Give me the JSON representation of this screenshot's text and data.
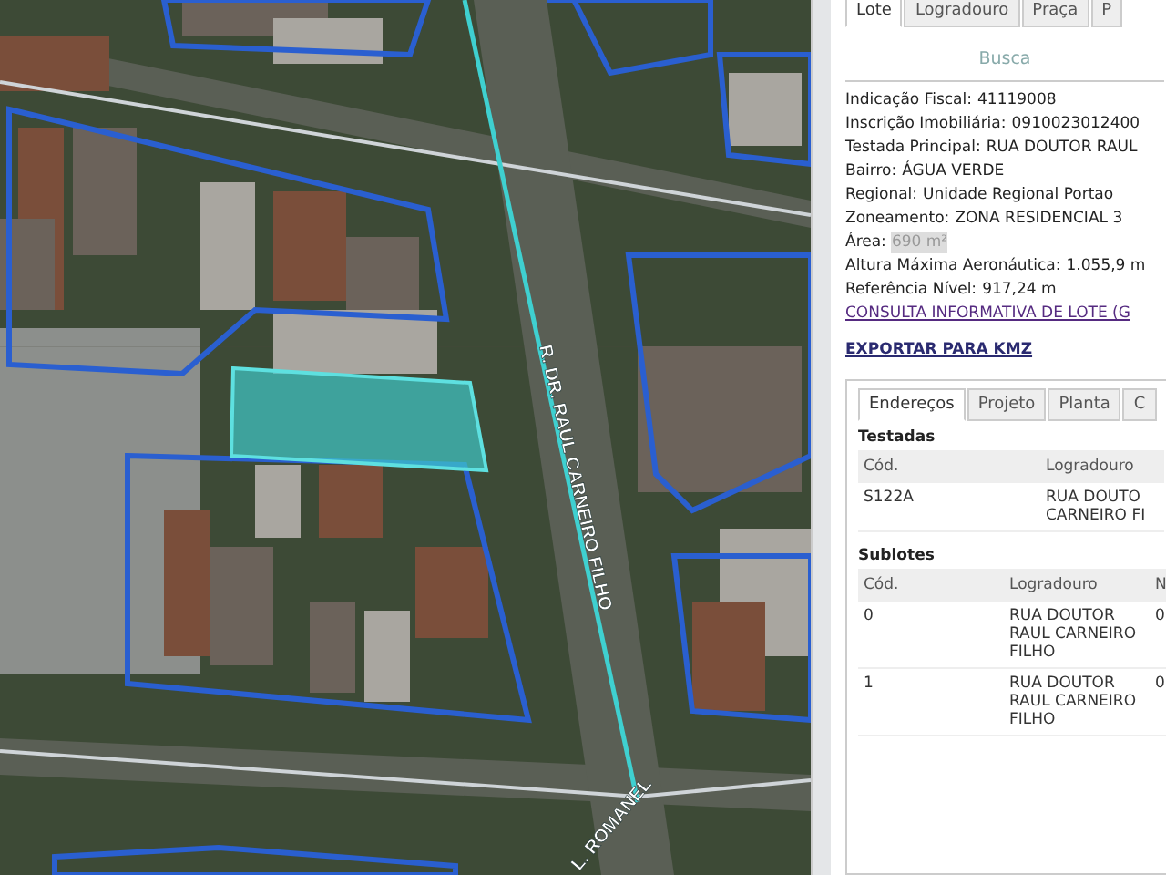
{
  "map": {
    "street_labels": [
      "R. DR. RAUL CARNEIRO FILHO",
      "L. ROMANEL"
    ]
  },
  "tabs": [
    {
      "label": "Lote",
      "selected": true
    },
    {
      "label": "Logradouro",
      "selected": false
    },
    {
      "label": "Praça",
      "selected": false
    },
    {
      "label": "P",
      "selected": false
    }
  ],
  "search_button": "Busca",
  "details": [
    {
      "label": "Indicação Fiscal:",
      "value": "41119008",
      "highlighted": false
    },
    {
      "label": "Inscrição Imobiliária:",
      "value": "0910023012400",
      "highlighted": false
    },
    {
      "label": "Testada Principal:",
      "value": "RUA DOUTOR RAUL",
      "highlighted": false
    },
    {
      "label": "Bairro:",
      "value": "ÁGUA VERDE",
      "highlighted": false
    },
    {
      "label": "Regional:",
      "value": "Unidade Regional Portao",
      "highlighted": false
    },
    {
      "label": "Zoneamento:",
      "value": "ZONA RESIDENCIAL 3",
      "highlighted": false
    },
    {
      "label": "Área:",
      "value": "690 m²",
      "highlighted": true
    },
    {
      "label": "Altura Máxima Aeronáutica:",
      "value": "1.055,9 m",
      "highlighted": false
    },
    {
      "label": "Referência Nível:",
      "value": "917,24 m",
      "highlighted": false
    }
  ],
  "links": [
    "CONSULTA INFORMATIVA DE LOTE (G",
    "EXPORTAR PARA KMZ"
  ],
  "sub_tabs": [
    {
      "label": "Endereços",
      "selected": true
    },
    {
      "label": "Projeto",
      "selected": false
    },
    {
      "label": "Planta",
      "selected": false
    },
    {
      "label": "C",
      "selected": false
    }
  ],
  "testadas": {
    "title": "Testadas",
    "columns": [
      "Cód.",
      "Logradouro"
    ],
    "rows": [
      [
        "S122A",
        "RUA DOUTO CARNEIRO FI"
      ]
    ]
  },
  "sublotes": {
    "title": "Sublotes",
    "columns": [
      "Cód.",
      "Logradouro",
      "N"
    ],
    "rows": [
      [
        "0",
        "RUA DOUTOR RAUL CARNEIRO FILHO",
        "0"
      ],
      [
        "1",
        "RUA DOUTOR RAUL CARNEIRO FILHO",
        "0"
      ]
    ]
  }
}
